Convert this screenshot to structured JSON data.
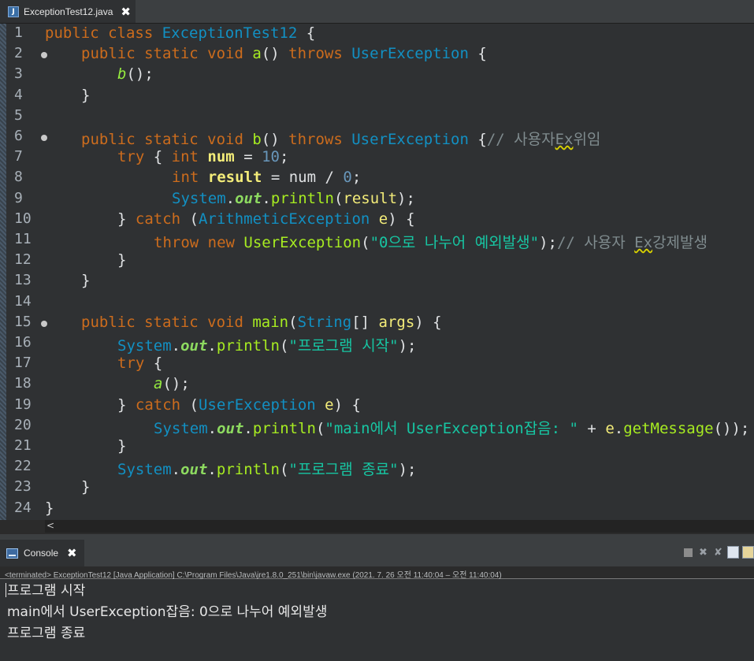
{
  "editor_tab": {
    "icon": "java-file-icon",
    "label": "ExceptionTest12.java",
    "close": "✖"
  },
  "code_lines": [
    {
      "n": "1",
      "fold": false
    },
    {
      "n": "2",
      "fold": true
    },
    {
      "n": "3",
      "fold": false
    },
    {
      "n": "4",
      "fold": false
    },
    {
      "n": "5",
      "fold": false
    },
    {
      "n": "6",
      "fold": true
    },
    {
      "n": "7",
      "fold": false
    },
    {
      "n": "8",
      "fold": false
    },
    {
      "n": "9",
      "fold": false
    },
    {
      "n": "10",
      "fold": false
    },
    {
      "n": "11",
      "fold": false
    },
    {
      "n": "12",
      "fold": false
    },
    {
      "n": "13",
      "fold": false
    },
    {
      "n": "14",
      "fold": false
    },
    {
      "n": "15",
      "fold": true
    },
    {
      "n": "16",
      "fold": false
    },
    {
      "n": "17",
      "fold": false
    },
    {
      "n": "18",
      "fold": false
    },
    {
      "n": "19",
      "fold": false
    },
    {
      "n": "20",
      "fold": false
    },
    {
      "n": "21",
      "fold": false
    },
    {
      "n": "22",
      "fold": false
    },
    {
      "n": "23",
      "fold": false
    },
    {
      "n": "24",
      "fold": false
    }
  ],
  "code": {
    "l1": [
      "public",
      " class ",
      "ExceptionTest12",
      " {"
    ],
    "l2": [
      "public static void ",
      "a",
      "() ",
      "throws ",
      "UserException",
      " {"
    ],
    "l3": [
      "b",
      "();"
    ],
    "l4": [
      "}"
    ],
    "l6": [
      "public static void ",
      "b",
      "() ",
      "throws ",
      "UserException",
      " {",
      "// 사용자",
      "Ex",
      "위임"
    ],
    "l7": [
      "try",
      " { ",
      "int ",
      "num",
      " = ",
      "10",
      ";"
    ],
    "l8": [
      "int ",
      "result",
      " = num / ",
      "0",
      ";"
    ],
    "l9": [
      "System",
      ".",
      "out",
      ".",
      "println",
      "(",
      "result",
      ");"
    ],
    "l10": [
      "} ",
      "catch",
      " (",
      "ArithmeticException",
      " ",
      "e",
      ") {"
    ],
    "l11": [
      "throw new ",
      "UserException",
      "(",
      "\"0으로 나누어 예외발생\"",
      ");",
      "// 사용자 ",
      "Ex",
      "강제발생"
    ],
    "l12": [
      "}"
    ],
    "l13": [
      "}"
    ],
    "l15": [
      "public static void ",
      "main",
      "(",
      "String",
      "[] ",
      "args",
      ") {"
    ],
    "l16": [
      "System",
      ".",
      "out",
      ".",
      "println",
      "(",
      "\"프로그램 시작\"",
      ");"
    ],
    "l17": [
      "try",
      " {"
    ],
    "l18": [
      "a",
      "();"
    ],
    "l19": [
      "} ",
      "catch",
      " (",
      "UserException",
      " ",
      "e",
      ") {"
    ],
    "l20": [
      "System",
      ".",
      "out",
      ".",
      "println",
      "(",
      "\"main에서 UserException잡음: \"",
      " + ",
      "e",
      ".",
      "getMessage",
      "());"
    ],
    "l21": [
      "}"
    ],
    "l22": [
      "System",
      ".",
      "out",
      ".",
      "println",
      "(",
      "\"프로그램 종료\"",
      ");"
    ],
    "l23": [
      "}"
    ],
    "l24": [
      "}"
    ]
  },
  "scroll_arrow": "<",
  "console": {
    "tab_label": "Console",
    "close": "✖",
    "toolbar": [
      "stop-icon",
      "remove-launch-icon",
      "remove-all-icon",
      "scroll-lock-icon",
      "word-wrap-icon"
    ],
    "info": "<terminated> ExceptionTest12 [Java Application] C:\\Program Files\\Java\\jre1.8.0_251\\bin\\javaw.exe  (2021. 7. 26 오전 11:40:04 – 오전 11:40:04)",
    "output": [
      "프로그램 시작",
      "main에서 UserException잡음: 0으로 나누어 예외발생",
      "프로그램 종료"
    ]
  }
}
